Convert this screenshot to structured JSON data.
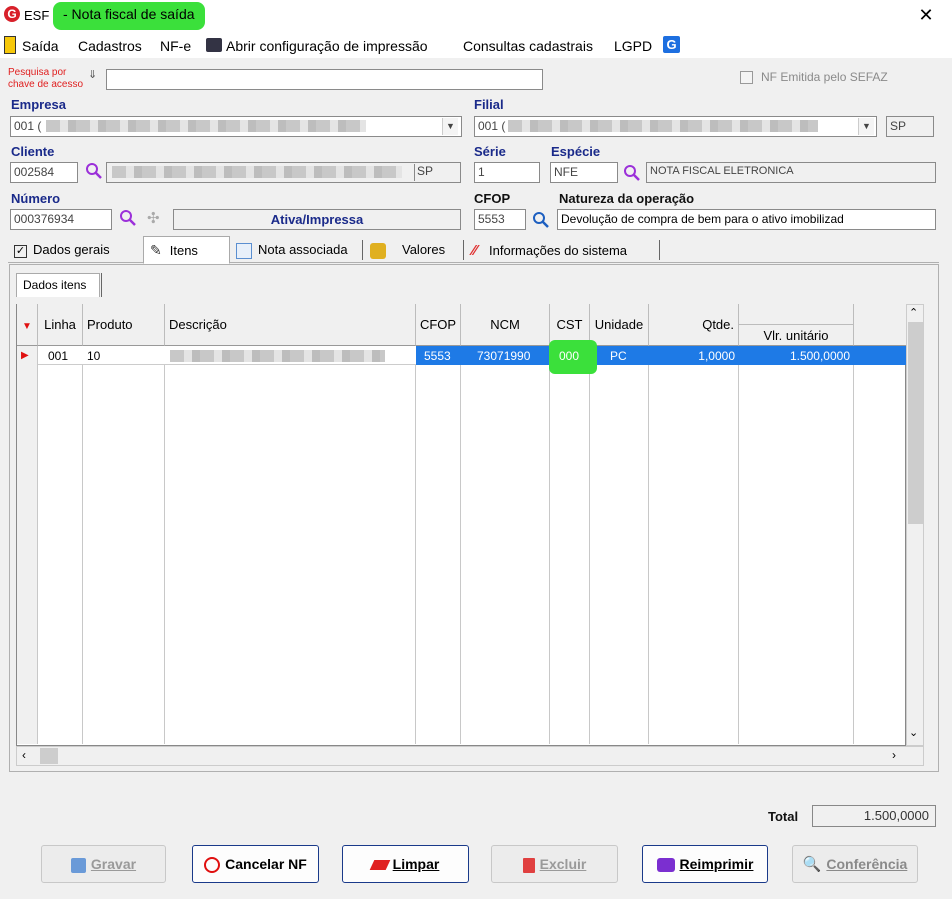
{
  "window": {
    "app_name": "ESF",
    "title": "- Nota fiscal de saída",
    "close_glyph": "✕"
  },
  "menu": {
    "items": [
      "Saída",
      "Cadastros",
      "NF-e",
      "Abrir configuração de impressão",
      "Consultas cadastrais",
      "LGPD"
    ]
  },
  "search": {
    "label_line1": "Pesquisa por",
    "label_line2": "chave de acesso",
    "value": ""
  },
  "sefaz_checkbox": {
    "label": "NF Emitida pelo SEFAZ",
    "checked": false
  },
  "empresa": {
    "label": "Empresa",
    "value": "001 ("
  },
  "filial": {
    "label": "Filial",
    "value": "001 (",
    "uf": "SP"
  },
  "cliente": {
    "label": "Cliente",
    "code": "002584",
    "uf": "SP"
  },
  "serie": {
    "label": "Série",
    "value": "1"
  },
  "especie": {
    "label": "Espécie",
    "code": "NFE",
    "description": "NOTA FISCAL ELETRONICA"
  },
  "numero": {
    "label": "Número",
    "value": "000376934",
    "status": "Ativa/Impressa"
  },
  "cfop": {
    "label": "CFOP",
    "value": "5553"
  },
  "natureza": {
    "label": "Natureza da operação",
    "value": "Devolução de compra de bem para o ativo imobilizad"
  },
  "tabs": [
    "Dados gerais",
    "Itens",
    "Nota associada",
    "Valores",
    "Informações do sistema"
  ],
  "items_panel": {
    "subtab": "Dados itens",
    "columns": [
      "Linha",
      "Produto",
      "Descrição",
      "CFOP",
      "NCM",
      "CST",
      "Unidade",
      "Qtde.",
      "Vlr. unitário"
    ],
    "rows": [
      {
        "linha": "001",
        "produto": "10",
        "descricao": "",
        "cfop": "5553",
        "ncm": "73071990",
        "cst": "000",
        "unidade": "PC",
        "qtde": "1,0000",
        "vlr_unitario": "1.500,0000"
      }
    ]
  },
  "total": {
    "label": "Total",
    "value": "1.500,0000"
  },
  "buttons": {
    "gravar": "Gravar",
    "cancelar": "Cancelar NF",
    "limpar": "Limpar",
    "excluir": "Excluir",
    "reimprimir": "Reimprimir",
    "conferencia": "Conferência"
  },
  "colors": {
    "accent_highlight": "#3be03b",
    "selection_blue": "#1e7ae6",
    "label_blue": "#1a2a8a"
  }
}
